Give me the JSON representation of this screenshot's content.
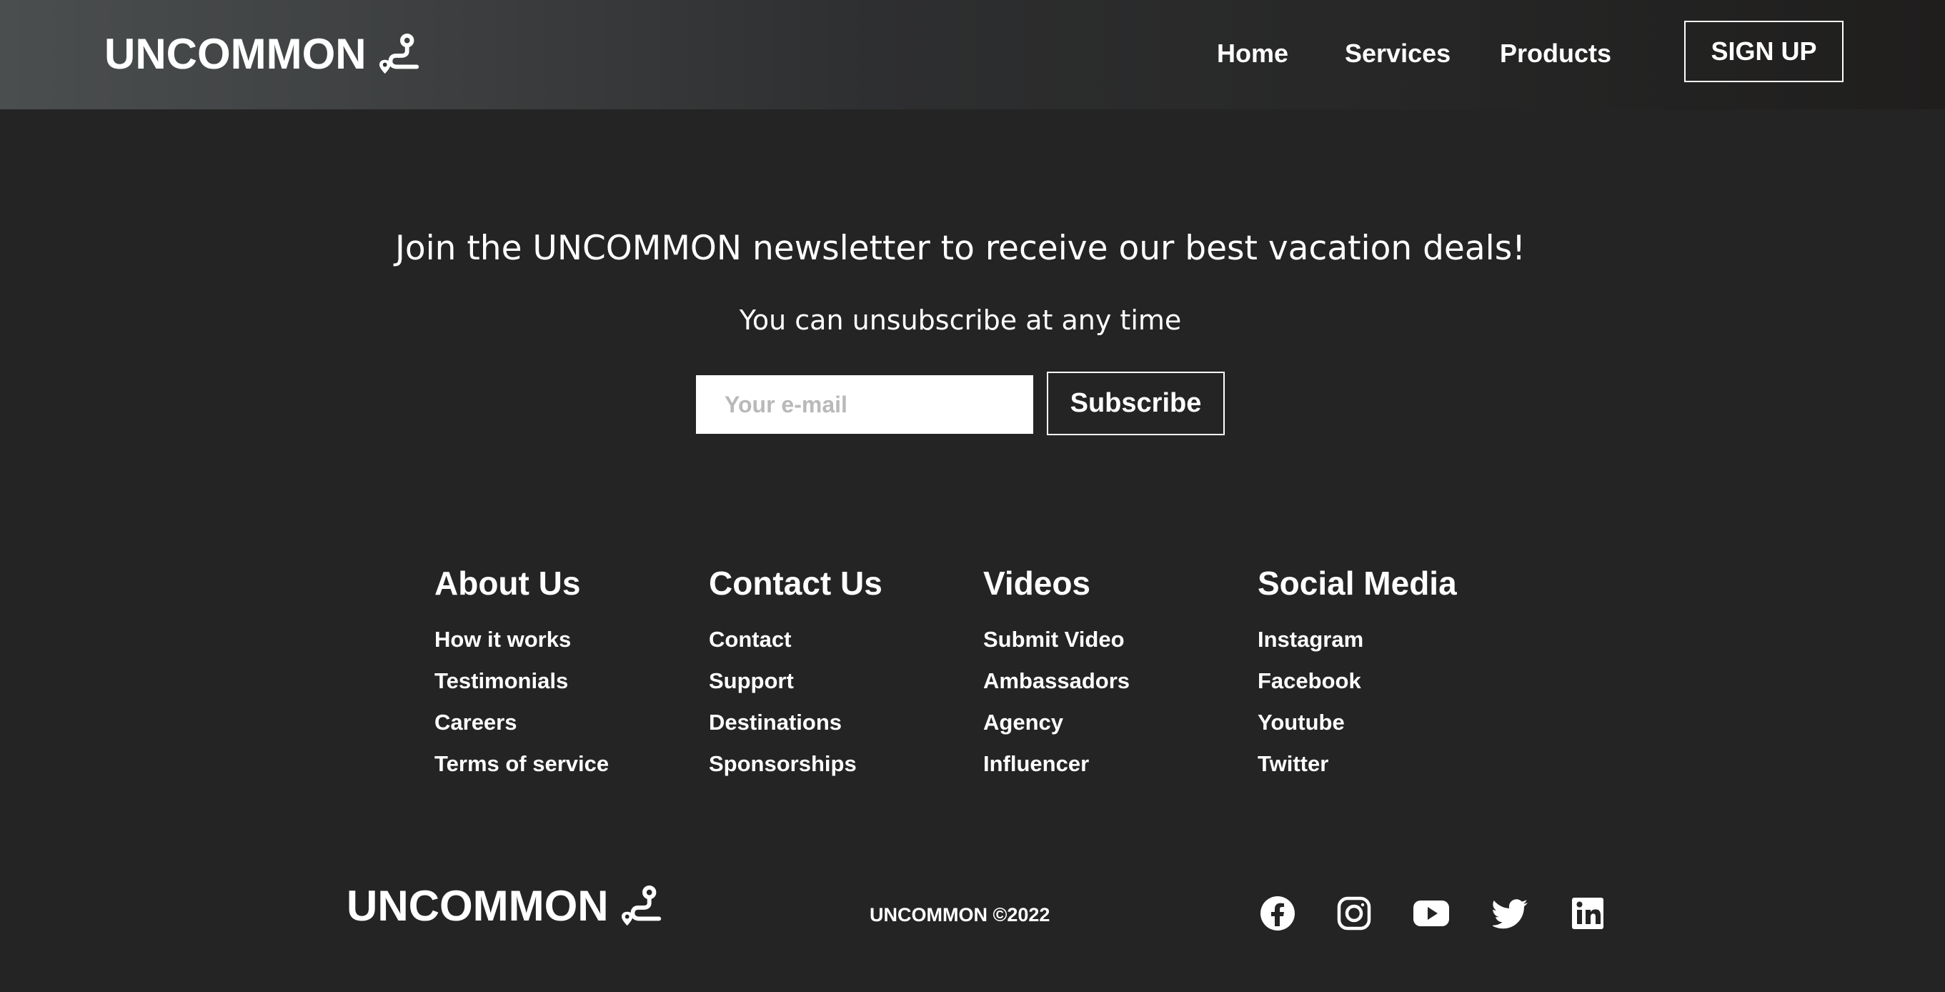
{
  "header": {
    "brand": "UNCOMMON",
    "brand_icon": "route-icon",
    "nav": [
      "Home",
      "Services",
      "Products"
    ],
    "signup_label": "SIGN UP"
  },
  "newsletter": {
    "title": "Join the UNCOMMON newsletter to receive our best vacation deals!",
    "subtitle": "You can unsubscribe at any time",
    "email_placeholder": "Your e-mail",
    "email_value": "",
    "subscribe_label": "Subscribe"
  },
  "footer": {
    "columns": [
      {
        "heading": "About Us",
        "links": [
          "How it works",
          "Testimonials",
          "Careers",
          "Terms of service"
        ]
      },
      {
        "heading": "Contact Us",
        "links": [
          "Contact",
          "Support",
          "Destinations",
          "Sponsorships"
        ]
      },
      {
        "heading": "Videos",
        "links": [
          "Submit Video",
          "Ambassadors",
          "Agency",
          "Influencer"
        ]
      },
      {
        "heading": "Social Media",
        "links": [
          "Instagram",
          "Facebook",
          "Youtube",
          "Twitter"
        ]
      }
    ],
    "brand": "UNCOMMON",
    "copyright": "UNCOMMON ©2022",
    "social_icons": [
      "facebook-icon",
      "instagram-icon",
      "youtube-icon",
      "twitter-icon",
      "linkedin-icon"
    ]
  },
  "colors": {
    "background": "#242424",
    "header_gradient_start": "#4b4e4f",
    "header_gradient_end": "#1f1e1d",
    "text": "#ffffff",
    "input_background": "#ffffff",
    "placeholder": "#b9b9b9"
  }
}
